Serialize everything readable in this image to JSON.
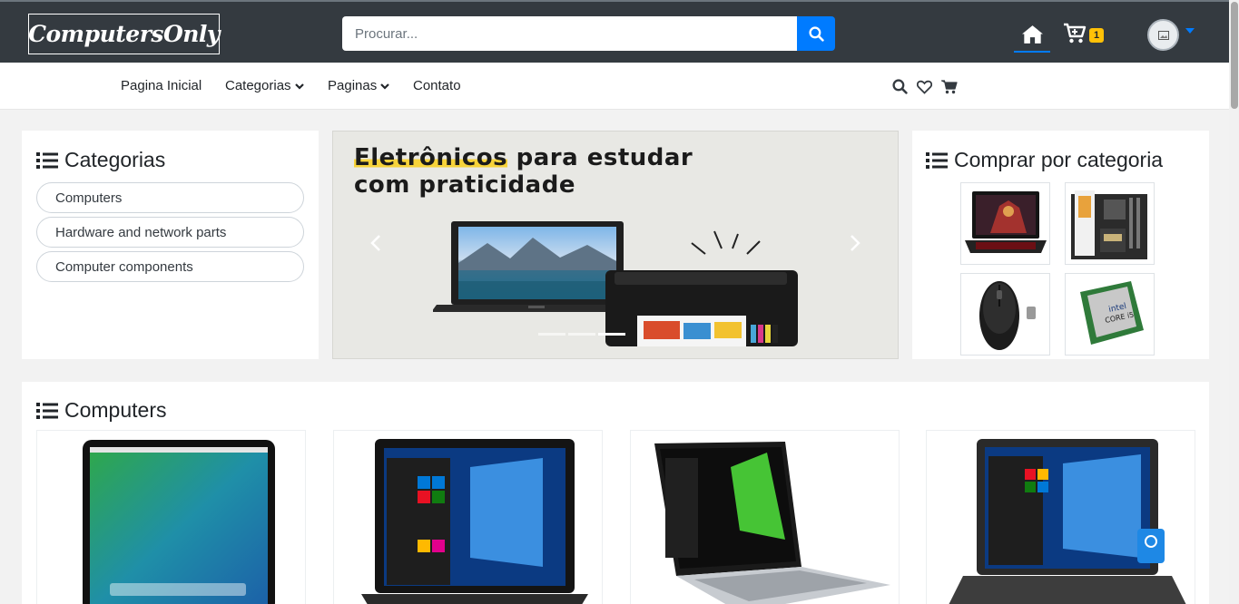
{
  "header": {
    "brand": "ComputersOnly",
    "search_placeholder": "Procurar...",
    "cart_count": "1"
  },
  "nav": {
    "items": [
      {
        "label": "Pagina Inicial"
      },
      {
        "label": "Categorias"
      },
      {
        "label": "Paginas"
      },
      {
        "label": "Contato"
      }
    ]
  },
  "categories_panel": {
    "title": "Categorias",
    "items": [
      {
        "label": "Computers"
      },
      {
        "label": "Hardware and network parts"
      },
      {
        "label": "Computer components"
      }
    ]
  },
  "banner": {
    "headline_highlight": "Eletrônicos",
    "headline_rest": " para estudar",
    "headline_line2": "com praticidade",
    "slide_count": 3,
    "active_slide": 3
  },
  "shop_by_category": {
    "title": "Comprar por categoria",
    "thumbnails": [
      {
        "icon": "gaming-laptop-image"
      },
      {
        "icon": "motherboard-image"
      },
      {
        "icon": "wireless-mouse-image"
      },
      {
        "icon": "intel-core-i5-cpu-image"
      }
    ]
  },
  "computers_section": {
    "title": "Computers",
    "products": [
      {
        "icon": "macbook-image"
      },
      {
        "icon": "dell-laptop-image"
      },
      {
        "icon": "acer-laptop-image"
      },
      {
        "icon": "hp-laptop-image"
      }
    ]
  },
  "colors": {
    "topbar": "#343a40",
    "primary": "#007bff",
    "badge": "#ffc107"
  }
}
